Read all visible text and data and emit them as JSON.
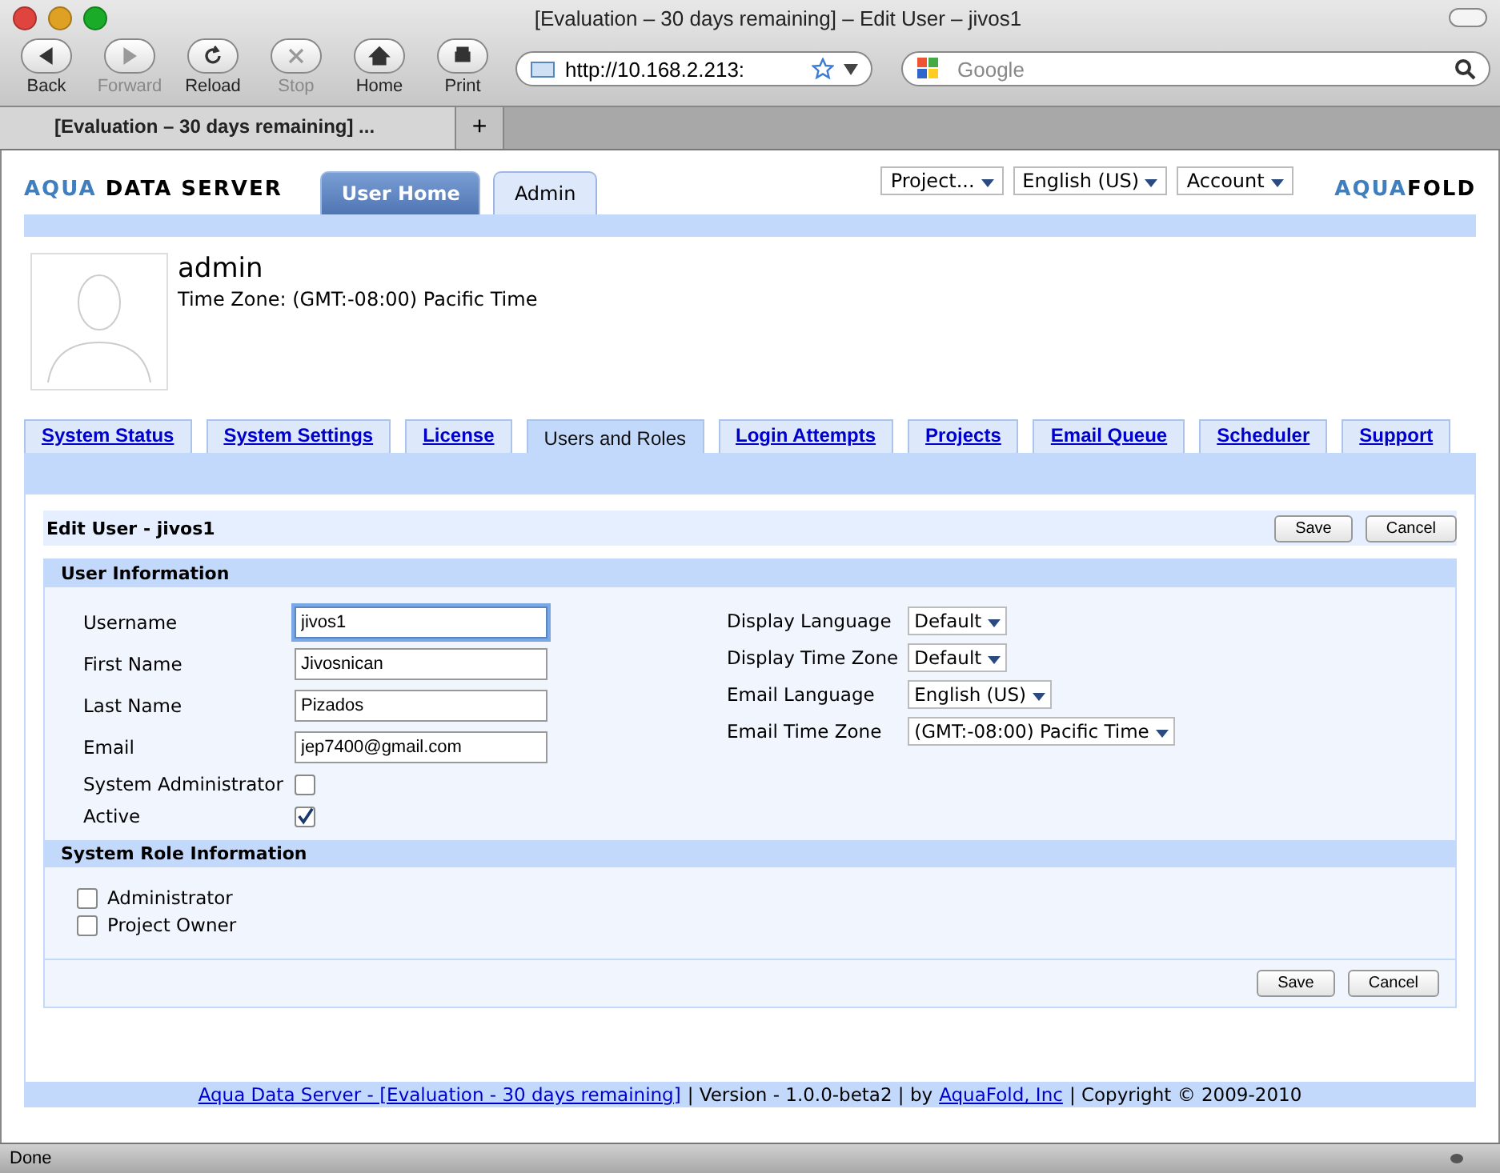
{
  "window": {
    "title": "[Evaluation – 30 days remaining] – Edit User – jivos1"
  },
  "toolbar": [
    {
      "label": "Back",
      "disabled": false,
      "kind": "back"
    },
    {
      "label": "Forward",
      "disabled": true,
      "kind": "forward"
    },
    {
      "label": "Reload",
      "disabled": false,
      "kind": "reload"
    },
    {
      "label": "Stop",
      "disabled": true,
      "kind": "stop"
    },
    {
      "label": "Home",
      "disabled": false,
      "kind": "home"
    },
    {
      "label": "Print",
      "disabled": false,
      "kind": "print"
    }
  ],
  "address": {
    "value": "http://10.168.2.213:"
  },
  "search": {
    "placeholder": "Google"
  },
  "browser_tabs": [
    {
      "label": "[Evaluation – 30 days remaining] ...",
      "selected": true
    }
  ],
  "new_tab": "+",
  "app_logo": {
    "accent": "AQUA",
    "rest": "DATA SERVER"
  },
  "app_tabs": [
    {
      "label": "User Home",
      "selected": false
    },
    {
      "label": "Admin",
      "selected": true
    }
  ],
  "menus": [
    "Project...",
    "English (US)",
    "Account"
  ],
  "company_logo": {
    "accent": "AQUA",
    "rest": "FOLD"
  },
  "user": {
    "name": "admin",
    "timezone": "Time Zone: (GMT:-08:00) Pacific Time"
  },
  "admin_tabs": [
    {
      "label": "System Status",
      "selected": false
    },
    {
      "label": "System Settings",
      "selected": false
    },
    {
      "label": "License",
      "selected": false
    },
    {
      "label": "Users and Roles",
      "selected": true
    },
    {
      "label": "Login Attempts",
      "selected": false
    },
    {
      "label": "Projects",
      "selected": false
    },
    {
      "label": "Email Queue",
      "selected": false
    },
    {
      "label": "Scheduler",
      "selected": false
    },
    {
      "label": "Support",
      "selected": false
    }
  ],
  "form": {
    "title": "Edit User - jivos1",
    "buttons": [
      "Save",
      "Cancel"
    ],
    "user_info": {
      "heading": "User Information",
      "fields": [
        {
          "label": "Username",
          "kind": "text",
          "value": "jivos1",
          "focused": true
        },
        {
          "label": "First Name",
          "kind": "text",
          "value": "Jivosnican",
          "focused": false
        },
        {
          "label": "Last Name",
          "kind": "text",
          "value": "Pizados",
          "focused": false
        },
        {
          "label": "Email",
          "kind": "text",
          "value": "jep7400@gmail.com",
          "focused": false
        },
        {
          "label": "System Administrator",
          "kind": "checkbox",
          "checked": false
        },
        {
          "label": "Active",
          "kind": "checkbox",
          "checked": true
        }
      ],
      "selects": [
        {
          "label": "Display Language",
          "value": "Default"
        },
        {
          "label": "Display Time Zone",
          "value": "Default"
        },
        {
          "label": "Email Language",
          "value": "English (US)"
        },
        {
          "label": "Email Time Zone",
          "value": "(GMT:-08:00) Pacific Time"
        }
      ]
    },
    "roles": {
      "heading": "System Role Information",
      "items": [
        {
          "label": "Administrator",
          "checked": false
        },
        {
          "label": "Project Owner",
          "checked": false
        }
      ]
    },
    "bottom_buttons": [
      "Save",
      "Cancel"
    ]
  },
  "footer": [
    {
      "kind": "link",
      "text": "Aqua Data Server - [Evaluation - 30 days remaining]"
    },
    {
      "kind": "text",
      "text": "| Version - 1.0.0-beta2 | by"
    },
    {
      "kind": "link",
      "text": "AquaFold, Inc"
    },
    {
      "kind": "text",
      "text": "| Copyright © 2009-2010"
    }
  ],
  "status_bar": {
    "text": "Done"
  }
}
